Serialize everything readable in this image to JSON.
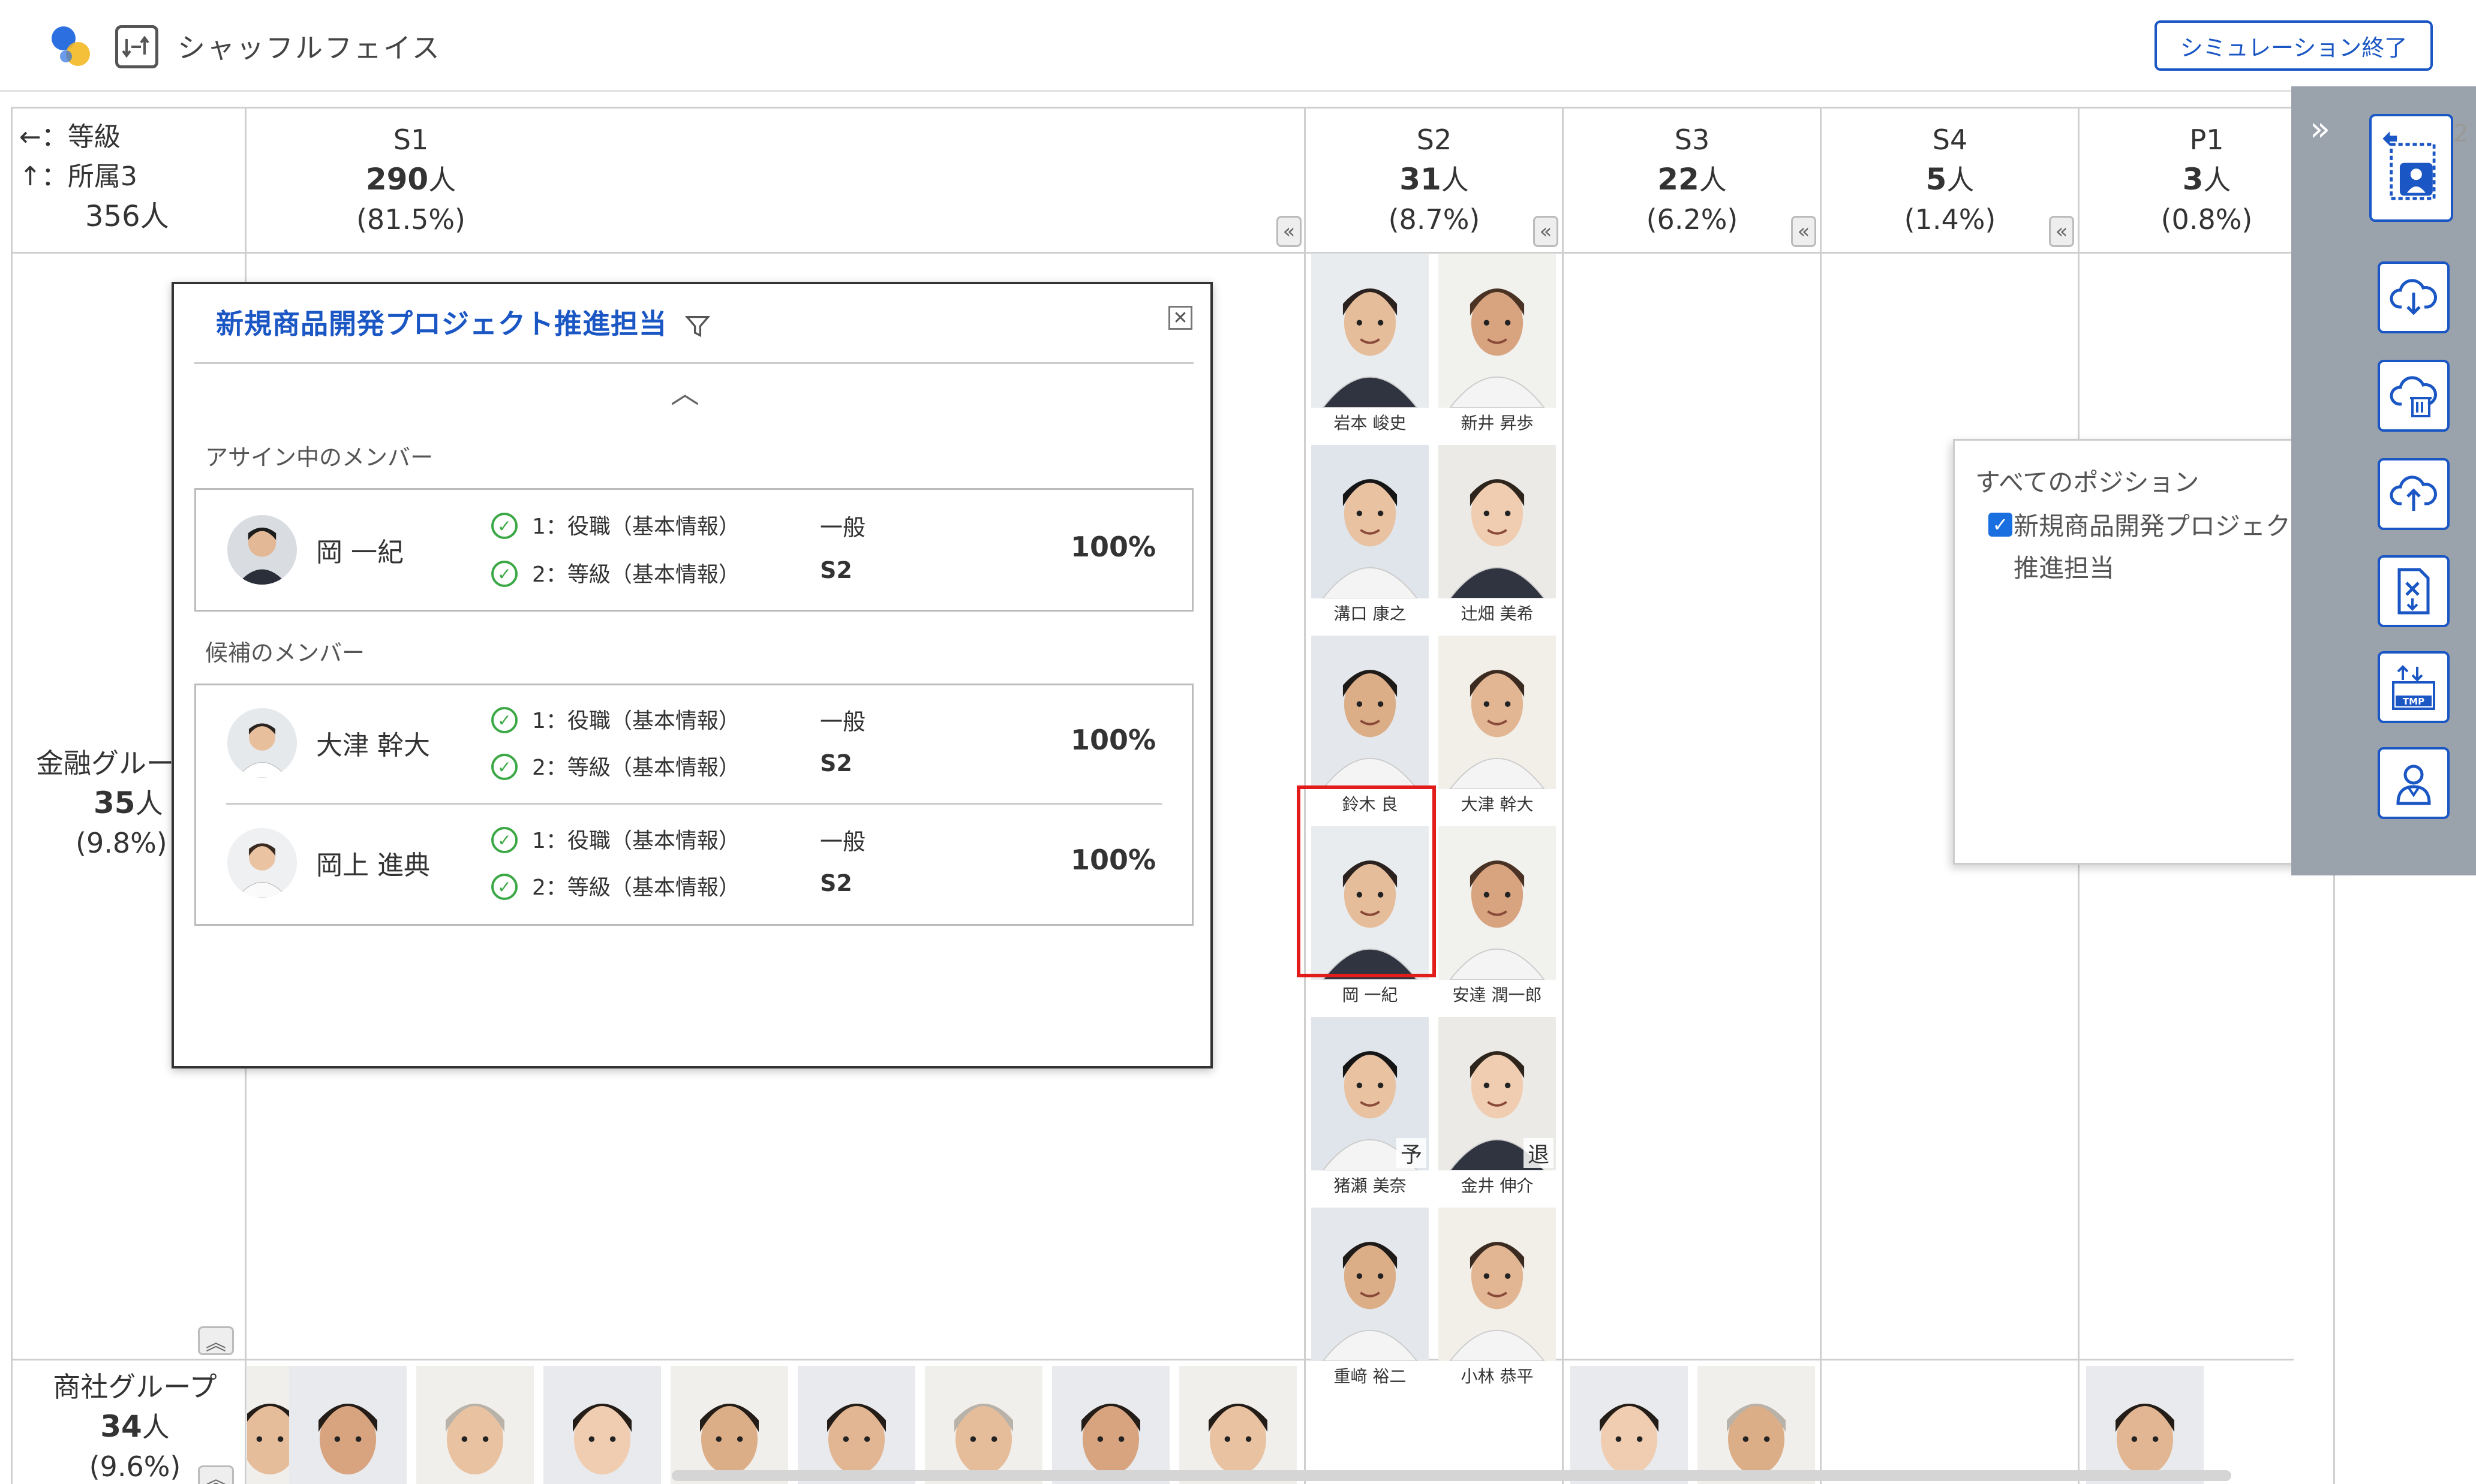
{
  "header": {
    "app_title": "シャッフルフェイス",
    "end_button": "シミュレーション終了"
  },
  "corner": {
    "x_axis": "←：等級",
    "y_axis": "↑：所属3",
    "total": "356人"
  },
  "columns": [
    {
      "name": "S1",
      "count": "290",
      "unit": "人",
      "pct": "(81.5%)"
    },
    {
      "name": "S2",
      "count": "31",
      "unit": "人",
      "pct": "(8.7%)"
    },
    {
      "name": "S3",
      "count": "22",
      "unit": "人",
      "pct": "(6.2%)"
    },
    {
      "name": "S4",
      "count": "5",
      "unit": "人",
      "pct": "(1.4%)"
    },
    {
      "name": "P1",
      "count": "3",
      "unit": "人",
      "pct": "(0.8%)"
    }
  ],
  "rows": [
    {
      "name": "金融グルー",
      "count": "35",
      "unit": "人",
      "pct": "(9.8%)"
    },
    {
      "name": "商社グループ",
      "count": "34",
      "unit": "人",
      "pct": "(9.6%)"
    }
  ],
  "s2_people": [
    {
      "name": "岩本 峻史",
      "badge": ""
    },
    {
      "name": "新井 昇歩",
      "badge": ""
    },
    {
      "name": "溝口 康之",
      "badge": ""
    },
    {
      "name": "辻畑 美希",
      "badge": ""
    },
    {
      "name": "鈴木 良",
      "badge": ""
    },
    {
      "name": "大津 幹大",
      "badge": ""
    },
    {
      "name": "岡 一紀",
      "badge": ""
    },
    {
      "name": "安達 潤一郎",
      "badge": ""
    },
    {
      "name": "猪瀬 美奈",
      "badge": "予"
    },
    {
      "name": "金井 伸介",
      "badge": "退"
    },
    {
      "name": "重﨑 裕二",
      "badge": ""
    },
    {
      "name": "小林 恭平",
      "badge": ""
    }
  ],
  "popup": {
    "title": "新規商品開発プロジェクト推進担当",
    "assigned_label": "アサイン中のメンバー",
    "candidate_label": "候補のメンバー",
    "assigned": [
      {
        "name": "岡 一紀",
        "cond1": "1：役職（基本情報）",
        "val1": "一般",
        "cond2": "2：等級（基本情報）",
        "val2": "S2",
        "pct": "100%"
      }
    ],
    "candidates": [
      {
        "name": "大津 幹大",
        "cond1": "1：役職（基本情報）",
        "val1": "一般",
        "cond2": "2：等級（基本情報）",
        "val2": "S2",
        "pct": "100%"
      },
      {
        "name": "岡上 進典",
        "cond1": "1：役職（基本情報）",
        "val1": "一般",
        "cond2": "2：等級（基本情報）",
        "val2": "S2",
        "pct": "100%"
      }
    ]
  },
  "position_panel": {
    "title": "すべてのポジション",
    "item": "新規商品開発プロジェクト推進担当",
    "checked": true
  },
  "colors": {
    "accent": "#1a56c4",
    "check_green": "#3aa844",
    "selection_red": "#e21b1b",
    "toolbar_gray": "#9aa2ab"
  },
  "icons": [
    "logo-icon",
    "shuffle-icon",
    "filter-icon",
    "close-icon",
    "chevron-up-icon",
    "check-circle-icon",
    "collapse-left-icon",
    "expand-up-icon",
    "expand-right-icon",
    "profile-frame-icon",
    "cloud-download-icon",
    "cloud-delete-icon",
    "cloud-upload-icon",
    "excel-export-icon",
    "tmp-import-icon",
    "person-icon"
  ]
}
